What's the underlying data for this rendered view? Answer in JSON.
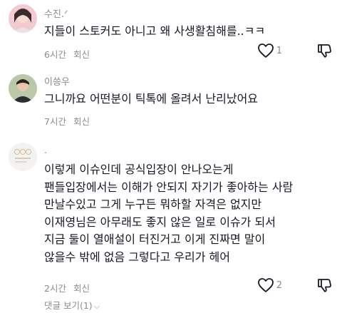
{
  "comments": [
    {
      "username": "수진.ᐟ",
      "text": "지들이 스토커도 아니고 왜 사생활침해를..ㅋㅋ",
      "time": "6시간",
      "reply_label": "회신",
      "like_count": "1",
      "avatar_icon": "profile-photo-icon"
    },
    {
      "username": "이씅우",
      "text": "그니까요 어떤분이 틱톡에 올려서 난리났어요",
      "time": "7시간",
      "reply_label": "회신",
      "like_count": "",
      "avatar_icon": "profile-photo-icon"
    },
    {
      "username": ".",
      "text": "이렇게 이슈인데 공식입장이 안나오는게\n팬들입장에서는 이해가 안되지 자기가 좋아하는 사람\n만날수있고 그게 누구든 뭐하할 자격은 없지만\n이재영님은 아무래도 좋지 않은 일로 이슈가 되서\n지금 둘이 열애설이 터진거고 이게 진짜면 말이\n않을수 밖에 없음 그렇다고 우리가 헤어",
      "time": "2시간",
      "reply_label": "회신",
      "like_count": "2",
      "avatar_icon": "profile-photo-icon"
    }
  ],
  "view_replies": {
    "label": "댓글 보기(1)",
    "chevron": "⌵"
  },
  "colors": {
    "text_primary": "#161823",
    "text_secondary": "#8a8b91",
    "background": "#ffffff"
  },
  "icons": {
    "like": "heart-outline-icon",
    "dislike": "thumbs-down-outline-icon"
  }
}
